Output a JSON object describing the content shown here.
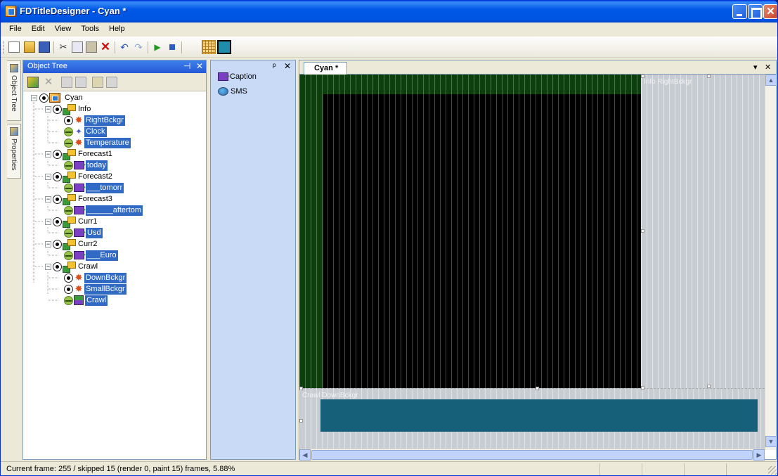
{
  "window": {
    "title": "FDTitleDesigner - Cyan *"
  },
  "menu": {
    "items": [
      "File",
      "Edit",
      "View",
      "Tools",
      "Help"
    ]
  },
  "toolbar": {
    "buttons": [
      "new-document-icon",
      "open-folder-icon",
      "save-icon",
      "cut-icon",
      "copy-icon",
      "paste-icon",
      "delete-icon",
      "undo-icon",
      "redo-icon",
      "play-icon",
      "stop-icon",
      "grid-icon",
      "preview-icon"
    ]
  },
  "side_tabs": {
    "object_tree": "Object Tree",
    "properties": "Properties"
  },
  "tree_panel": {
    "title": "Object Tree",
    "pin": "⊣",
    "close": "✕",
    "nodes": [
      {
        "label": "Cyan",
        "selected": false
      },
      {
        "label": "Info",
        "selected": false
      },
      {
        "label": "RightBckgr",
        "selected": true
      },
      {
        "label": "Clock",
        "selected": true
      },
      {
        "label": "Temperature",
        "selected": true
      },
      {
        "label": "Forecast1",
        "selected": false
      },
      {
        "label": "today",
        "selected": true
      },
      {
        "label": "Forecast2",
        "selected": false
      },
      {
        "label": "___tomorr",
        "selected": true
      },
      {
        "label": "Forecast3",
        "selected": false
      },
      {
        "label": "______aftertom",
        "selected": true
      },
      {
        "label": "Curr1",
        "selected": false
      },
      {
        "label": "Usd",
        "selected": true
      },
      {
        "label": "Curr2",
        "selected": false
      },
      {
        "label": "___Euro",
        "selected": true
      },
      {
        "label": "Crawl",
        "selected": false
      },
      {
        "label": "DownBckgr",
        "selected": true
      },
      {
        "label": "SmallBckgr",
        "selected": true
      },
      {
        "label": "Crawl",
        "selected": true
      }
    ]
  },
  "toolbox_panel": {
    "pin": "ᵖ",
    "close": "✕",
    "items": [
      "Caption",
      "SMS"
    ]
  },
  "document": {
    "tab": "Cyan *",
    "menu": "▾",
    "close": "✕",
    "right_bg_label": "Info RightBckgr",
    "down_bg_label": "Crawl DownBckgr"
  },
  "status": {
    "text": "Current frame: 255 / skipped 15 (render 0, paint 15) frames, 5.88%"
  },
  "colors": {
    "selection": "#316ac5",
    "canvas_green": "#0b3f0b",
    "crawl_bar": "#17607a"
  }
}
